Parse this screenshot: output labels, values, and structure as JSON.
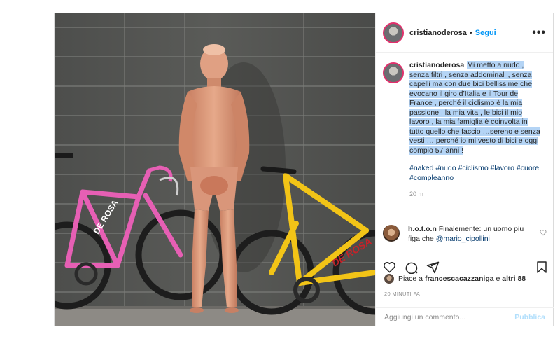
{
  "post": {
    "username": "cristianoderosa",
    "dot": "•",
    "follow_label": "Segui",
    "more_label": "•••",
    "caption_text": "Mi metto a nudo , senza filtri , senza addominali , senza capelli ma con due bici bellissime che evocano il giro d’Italia e il Tour de France , perché il ciclismo è la mia passione , la mia vita , le bici il mio lavoro , la mia famiglia è coinvolta in tutto quello che faccio …sereno e senza vesti … perché io mi vesto di bici e oggi compio 57 anni !",
    "hashtags": "#naked #nudo #ciclismo #lavoro #cuore #compleanno",
    "caption_time": "20 m",
    "photo_brand_text": "DE ROSA"
  },
  "comment": {
    "username": "h.o.t.o.n",
    "text": "Finalemente: un uomo piu figa che",
    "mention": "@mario_cipollini"
  },
  "likes": {
    "prefix": "Piace a",
    "user": "francescacazzaniga",
    "middle": "e",
    "others": "altri 88"
  },
  "time_ago": "20 MINUTI FA",
  "add_comment": {
    "placeholder": "Aggiungi un commento...",
    "publish_label": "Pubblica"
  },
  "icons": [
    "heart-icon",
    "comment-icon",
    "share-icon",
    "bookmark-icon",
    "more-icon"
  ],
  "colors": {
    "accent": "#0095f6",
    "pink_bike": "#e65fb4",
    "yellow_bike": "#f2c417",
    "selection": "#b4d4f5"
  }
}
